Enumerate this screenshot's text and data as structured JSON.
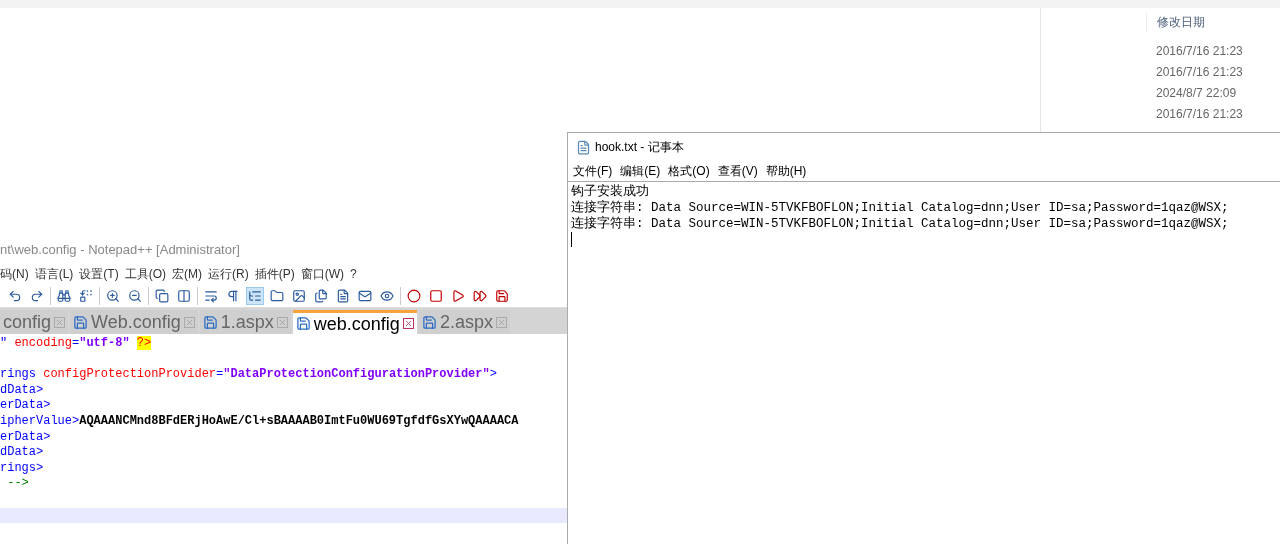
{
  "explorer": {
    "column_header": "修改日期",
    "dates": [
      "2016/7/16 21:23",
      "2016/7/16 21:23",
      "2024/8/7 22:09",
      "2016/7/16 21:23"
    ]
  },
  "notepadpp": {
    "title": "nt\\web.config - Notepad++ [Administrator]",
    "menu": [
      "码(N)",
      "语言(L)",
      "设置(T)",
      "工具(O)",
      "宏(M)",
      "运行(R)",
      "插件(P)",
      "窗口(W)",
      "?"
    ],
    "indent_guide_on": true,
    "tabs": [
      {
        "label": "config",
        "selected": false
      },
      {
        "label": "Web.config",
        "selected": false
      },
      {
        "label": "1.aspx",
        "selected": false
      },
      {
        "label": "web.config",
        "selected": true
      },
      {
        "label": "2.aspx",
        "selected": false
      }
    ],
    "lines": [
      [
        {
          "kind": "tag",
          "text": "\" "
        },
        {
          "kind": "attr",
          "text": "encoding"
        },
        {
          "kind": "tag",
          "text": "="
        },
        {
          "kind": "value",
          "text": "\"utf-8\""
        },
        {
          "kind": "pi",
          "text": "?>"
        }
      ],
      {
        "kind": "blank"
      },
      [
        {
          "kind": "tag",
          "text": "rings "
        },
        {
          "kind": "attr",
          "text": "configProtectionProvider"
        },
        {
          "kind": "tag",
          "text": "="
        },
        {
          "kind": "value",
          "text": "\"DataProtectionConfigurationProvider\""
        },
        {
          "kind": "tag",
          "text": ">"
        }
      ],
      [
        {
          "kind": "tag",
          "text": "dData>"
        }
      ],
      [
        {
          "kind": "tag",
          "text": "erData>"
        }
      ],
      [
        {
          "kind": "tag",
          "text": "ipherValue>"
        },
        {
          "kind": "text",
          "text": "AQAAANCMnd8BFdERjHoAwE/Cl+sBAAAAB0ImtFu0WU69TgfdfGsXYwQAAAACA"
        }
      ],
      [
        {
          "kind": "tag",
          "text": "erData>"
        }
      ],
      [
        {
          "kind": "tag",
          "text": "dData>"
        }
      ],
      [
        {
          "kind": "tag",
          "text": "rings>"
        }
      ],
      [
        {
          "kind": "comment",
          "text": " -->"
        }
      ],
      {
        "kind": "blank"
      },
      {
        "kind": "current"
      }
    ]
  },
  "notepad": {
    "title": "hook.txt - 记事本",
    "menu": [
      "文件(F)",
      "编辑(E)",
      "格式(O)",
      "查看(V)",
      "帮助(H)"
    ],
    "lines": [
      "钩子安装成功",
      "连接字符串: Data Source=WIN-5TVKFBOFLON;Initial Catalog=dnn;User ID=sa;Password=1qaz@WSX;",
      "连接字符串: Data Source=WIN-5TVKFBOFLON;Initial Catalog=dnn;User ID=sa;Password=1qaz@WSX;"
    ]
  }
}
